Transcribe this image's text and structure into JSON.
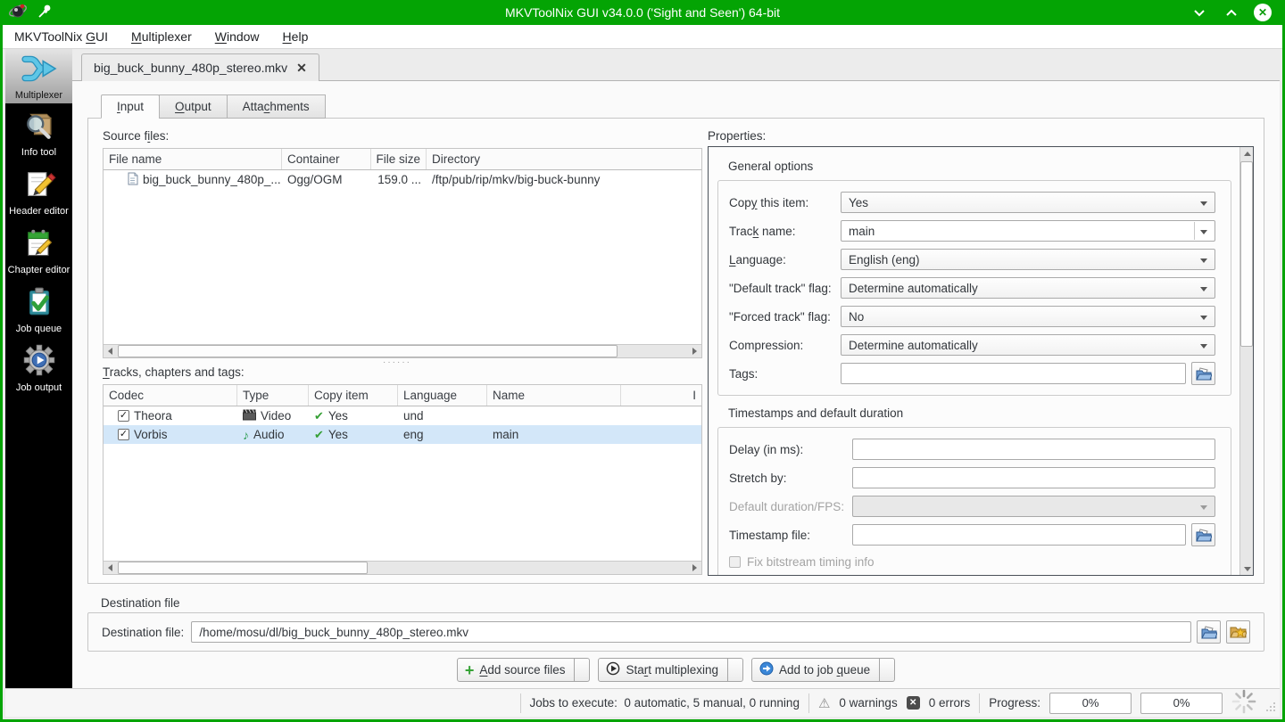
{
  "window": {
    "title": "MKVToolNix GUI v34.0.0 ('Sight and Seen') 64-bit"
  },
  "menubar": {
    "items": [
      {
        "label": "MKVToolNix &GUI"
      },
      {
        "label": "&Multiplexer"
      },
      {
        "label": "&Window"
      },
      {
        "label": "&Help"
      }
    ]
  },
  "sidebar": {
    "items": [
      {
        "label": "Multiplexer",
        "selected": true
      },
      {
        "label": "Info tool"
      },
      {
        "label": "Header editor"
      },
      {
        "label": "Chapter editor"
      },
      {
        "label": "Job queue"
      },
      {
        "label": "Job output"
      }
    ]
  },
  "file_tab": {
    "label": "big_buck_bunny_480p_stereo.mkv",
    "close_icon": "✕"
  },
  "tabs": [
    {
      "label": "&Input",
      "selected": true
    },
    {
      "label": "&Output"
    },
    {
      "label": "Atta&chments"
    }
  ],
  "source_files": {
    "label": "Source f&iles:",
    "columns": [
      "File name",
      "Container",
      "File size",
      "Directory"
    ],
    "rows": [
      {
        "file_name": "big_buck_bunny_480p_...",
        "container": "Ogg/OGM",
        "file_size": "159.0 ...",
        "directory": "/ftp/pub/rip/mkv/big-buck-bunny"
      }
    ]
  },
  "tracks": {
    "label": "&Tracks, chapters and tags:",
    "columns": [
      "Codec",
      "Type",
      "Copy item",
      "Language",
      "Name",
      "I"
    ],
    "rows": [
      {
        "codec": "Theora",
        "type": "Video",
        "copy": "Yes",
        "language": "und",
        "name": ""
      },
      {
        "codec": "Vorbis",
        "type": "Audio",
        "copy": "Yes",
        "language": "eng",
        "name": "main"
      }
    ]
  },
  "properties": {
    "label": "Properties:",
    "general": {
      "title": "General options",
      "copy_this_item": {
        "label": "Cop&y this item:",
        "value": "Yes"
      },
      "track_name": {
        "label": "Trac&k name:",
        "value": "main"
      },
      "language": {
        "label": "&Language:",
        "value": "English (eng)"
      },
      "default_track_flag": {
        "label": "\"Default track\" flag:",
        "value": "Determine automatically"
      },
      "forced_track_flag": {
        "label": "\"Forced track\" flag:",
        "value": "No"
      },
      "compression": {
        "label": "Compression:",
        "value": "Determine automatically"
      },
      "tags": {
        "label": "Tags:",
        "value": ""
      }
    },
    "timestamps": {
      "title": "Timestamps and default duration",
      "delay": {
        "label": "Delay (in ms):",
        "value": ""
      },
      "stretch_by": {
        "label": "Stretch by:",
        "value": ""
      },
      "default_duration": {
        "label": "Default duration/FPS:",
        "value": ""
      },
      "timestamp_file": {
        "label": "Timestamp file:",
        "value": ""
      },
      "fix_bitstream": {
        "label": "Fix bitstream timing info"
      }
    }
  },
  "destination": {
    "group_label": "Destination file",
    "field_label": "Destination file:",
    "value": "/home/mosu/dl/big_buck_bunny_480p_stereo.mkv"
  },
  "actions": {
    "add_source_files": "&Add source files",
    "start_multiplexing": "Sta&rt multiplexing",
    "add_to_job_queue": "Add to job &queue"
  },
  "statusbar": {
    "jobs": "Jobs to execute:  0 automatic, 5 manual, 0 running",
    "warnings": "0 warnings",
    "errors": "0 errors",
    "progress_label": "Progress:",
    "progress1": "0%",
    "progress2": "0%"
  },
  "icons": {
    "check": "✔",
    "row_check": "✓",
    "audio_note": "♪",
    "warning": "⚠",
    "error_x": "✕",
    "tab_close": "✕"
  },
  "colors": {
    "titlebar_green": "#04a404",
    "selection_blue": "#d3e7f9",
    "sidebar_black": "#000000"
  }
}
